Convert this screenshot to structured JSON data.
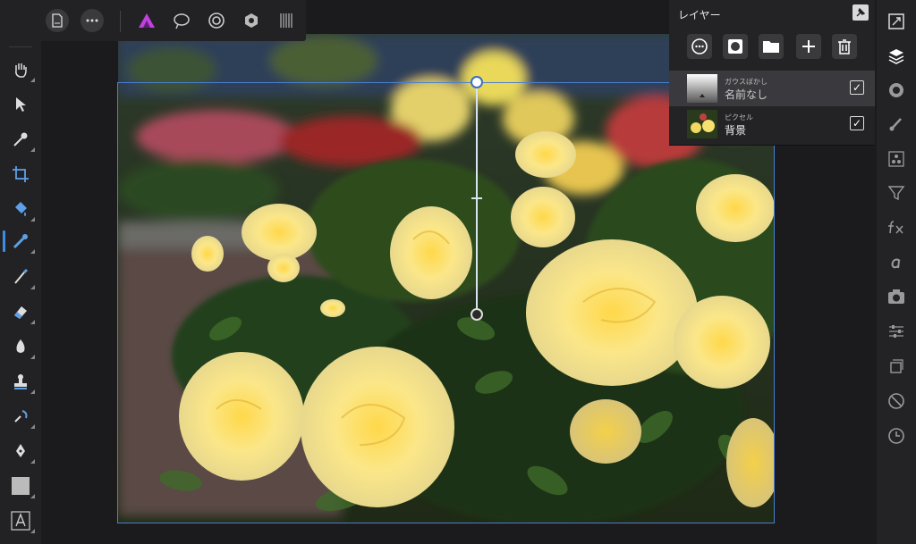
{
  "colors": {
    "accent": "#3d8de3",
    "persona": "#c040e0"
  },
  "top_toolbar": {
    "buttons": [
      {
        "name": "back-button",
        "icon": "arrow-left-icon"
      },
      {
        "name": "document-button",
        "icon": "document-icon"
      },
      {
        "name": "more-button",
        "icon": "ellipsis-icon"
      }
    ],
    "personas": [
      "photo-persona-icon",
      "liquify-persona-icon",
      "develop-persona-icon",
      "tone-mapping-persona-icon",
      "export-persona-icon"
    ]
  },
  "left_tools": [
    "hand-icon",
    "move-icon",
    "color-picker-icon",
    "crop-icon",
    "fill-icon",
    "gradient-icon",
    "paint-brush-icon",
    "eraser-icon",
    "dodge-icon",
    "clone-stamp-icon",
    "red-eye-icon",
    "pen-icon",
    "shape-icon",
    "text-icon"
  ],
  "layers_panel": {
    "title": "レイヤー",
    "actions": [
      "options-icon",
      "mask-icon",
      "group-icon",
      "add-icon",
      "delete-icon"
    ],
    "layers": [
      {
        "type": "ガウスぼかし",
        "name": "名前なし",
        "visible": true,
        "selected": true
      },
      {
        "type": "ピクセル",
        "name": "背景",
        "visible": true,
        "selected": false
      }
    ]
  },
  "right_studio": [
    "navigator-icon",
    "layers-icon",
    "color-icon",
    "brushes-icon",
    "channels-icon",
    "filter-icon",
    "fx-icon",
    "character-icon",
    "camera-icon",
    "adjustments-icon",
    "transform-icon",
    "history-icon",
    "clock-icon"
  ]
}
